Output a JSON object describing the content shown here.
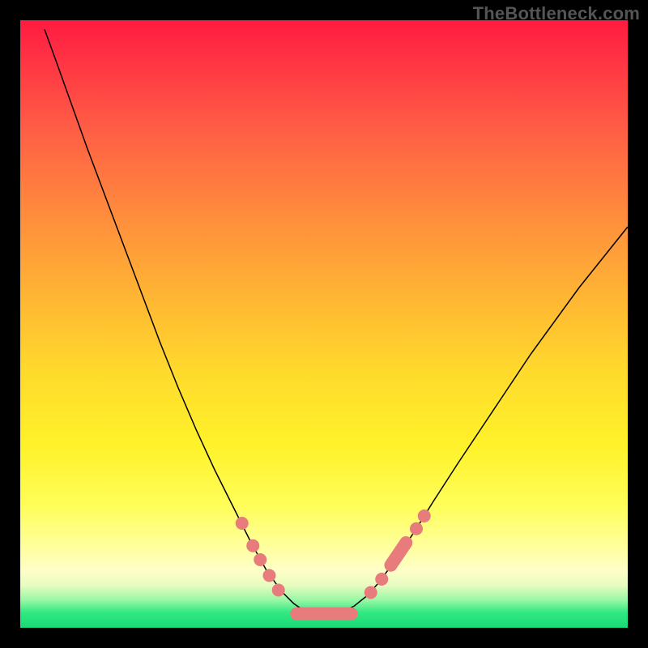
{
  "attribution": "TheBottleneck.com",
  "chart_data": {
    "type": "line",
    "title": "",
    "xlabel": "",
    "ylabel": "",
    "xlim": [
      0,
      100
    ],
    "ylim": [
      0,
      100
    ],
    "background": {
      "stops": [
        {
          "offset": 0.0,
          "color": "#FF1B3F"
        },
        {
          "offset": 0.05,
          "color": "#FF2E44"
        },
        {
          "offset": 0.18,
          "color": "#FF5E45"
        },
        {
          "offset": 0.32,
          "color": "#FF8C3D"
        },
        {
          "offset": 0.46,
          "color": "#FFB733"
        },
        {
          "offset": 0.58,
          "color": "#FFDA2C"
        },
        {
          "offset": 0.7,
          "color": "#FFF22A"
        },
        {
          "offset": 0.8,
          "color": "#FFFE5A"
        },
        {
          "offset": 0.87,
          "color": "#FFFFA0"
        },
        {
          "offset": 0.905,
          "color": "#FFFFC8"
        },
        {
          "offset": 0.93,
          "color": "#E8FCC0"
        },
        {
          "offset": 0.955,
          "color": "#96F7A4"
        },
        {
          "offset": 0.975,
          "color": "#31E981"
        },
        {
          "offset": 1.0,
          "color": "#18DA76"
        }
      ]
    },
    "series": [
      {
        "name": "curve",
        "color": "#000000",
        "width": 1.5,
        "points": [
          {
            "x": 4.0,
            "y": 98.5
          },
          {
            "x": 6.0,
            "y": 93.0
          },
          {
            "x": 8.5,
            "y": 86.0
          },
          {
            "x": 11.0,
            "y": 79.0
          },
          {
            "x": 14.0,
            "y": 71.0
          },
          {
            "x": 17.0,
            "y": 63.0
          },
          {
            "x": 20.0,
            "y": 55.0
          },
          {
            "x": 23.0,
            "y": 47.0
          },
          {
            "x": 26.0,
            "y": 39.5
          },
          {
            "x": 29.0,
            "y": 32.5
          },
          {
            "x": 32.0,
            "y": 26.0
          },
          {
            "x": 35.0,
            "y": 20.0
          },
          {
            "x": 38.0,
            "y": 14.0
          },
          {
            "x": 40.5,
            "y": 9.5
          },
          {
            "x": 43.0,
            "y": 6.0
          },
          {
            "x": 45.0,
            "y": 4.0
          },
          {
            "x": 47.0,
            "y": 2.6
          },
          {
            "x": 49.0,
            "y": 2.2
          },
          {
            "x": 51.0,
            "y": 2.2
          },
          {
            "x": 53.0,
            "y": 2.6
          },
          {
            "x": 55.0,
            "y": 3.6
          },
          {
            "x": 57.0,
            "y": 5.2
          },
          {
            "x": 59.0,
            "y": 7.4
          },
          {
            "x": 62.0,
            "y": 11.5
          },
          {
            "x": 65.0,
            "y": 16.0
          },
          {
            "x": 68.0,
            "y": 20.8
          },
          {
            "x": 72.0,
            "y": 27.0
          },
          {
            "x": 76.0,
            "y": 33.0
          },
          {
            "x": 80.0,
            "y": 39.0
          },
          {
            "x": 84.0,
            "y": 45.0
          },
          {
            "x": 88.0,
            "y": 50.5
          },
          {
            "x": 92.0,
            "y": 56.0
          },
          {
            "x": 96.0,
            "y": 61.0
          },
          {
            "x": 100.0,
            "y": 66.0
          }
        ]
      }
    ],
    "markers": {
      "color": "#E87B7B",
      "radius": 8,
      "capsules": [
        {
          "x1": 45.5,
          "x2": 54.5,
          "y": 2.3
        },
        {
          "x1": 61.0,
          "x2": 63.5,
          "y1": 10.3,
          "y2": 14.0
        }
      ],
      "points": [
        {
          "x": 36.5,
          "y": 17.2
        },
        {
          "x": 38.3,
          "y": 13.5
        },
        {
          "x": 39.5,
          "y": 11.2
        },
        {
          "x": 41.0,
          "y": 8.6
        },
        {
          "x": 42.5,
          "y": 6.2
        },
        {
          "x": 57.7,
          "y": 5.8
        },
        {
          "x": 59.5,
          "y": 8.0
        },
        {
          "x": 65.2,
          "y": 16.3
        },
        {
          "x": 66.5,
          "y": 18.4
        }
      ]
    }
  }
}
